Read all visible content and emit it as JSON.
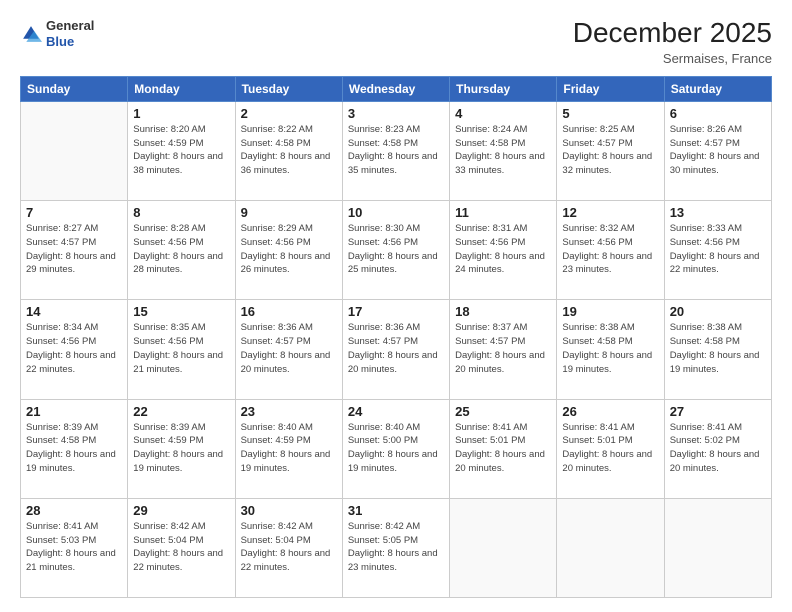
{
  "logo": {
    "general": "General",
    "blue": "Blue"
  },
  "title": "December 2025",
  "subtitle": "Sermaises, France",
  "days_header": [
    "Sunday",
    "Monday",
    "Tuesday",
    "Wednesday",
    "Thursday",
    "Friday",
    "Saturday"
  ],
  "weeks": [
    [
      {
        "num": "",
        "info": ""
      },
      {
        "num": "1",
        "info": "Sunrise: 8:20 AM\nSunset: 4:59 PM\nDaylight: 8 hours\nand 38 minutes."
      },
      {
        "num": "2",
        "info": "Sunrise: 8:22 AM\nSunset: 4:58 PM\nDaylight: 8 hours\nand 36 minutes."
      },
      {
        "num": "3",
        "info": "Sunrise: 8:23 AM\nSunset: 4:58 PM\nDaylight: 8 hours\nand 35 minutes."
      },
      {
        "num": "4",
        "info": "Sunrise: 8:24 AM\nSunset: 4:58 PM\nDaylight: 8 hours\nand 33 minutes."
      },
      {
        "num": "5",
        "info": "Sunrise: 8:25 AM\nSunset: 4:57 PM\nDaylight: 8 hours\nand 32 minutes."
      },
      {
        "num": "6",
        "info": "Sunrise: 8:26 AM\nSunset: 4:57 PM\nDaylight: 8 hours\nand 30 minutes."
      }
    ],
    [
      {
        "num": "7",
        "info": "Sunrise: 8:27 AM\nSunset: 4:57 PM\nDaylight: 8 hours\nand 29 minutes."
      },
      {
        "num": "8",
        "info": "Sunrise: 8:28 AM\nSunset: 4:56 PM\nDaylight: 8 hours\nand 28 minutes."
      },
      {
        "num": "9",
        "info": "Sunrise: 8:29 AM\nSunset: 4:56 PM\nDaylight: 8 hours\nand 26 minutes."
      },
      {
        "num": "10",
        "info": "Sunrise: 8:30 AM\nSunset: 4:56 PM\nDaylight: 8 hours\nand 25 minutes."
      },
      {
        "num": "11",
        "info": "Sunrise: 8:31 AM\nSunset: 4:56 PM\nDaylight: 8 hours\nand 24 minutes."
      },
      {
        "num": "12",
        "info": "Sunrise: 8:32 AM\nSunset: 4:56 PM\nDaylight: 8 hours\nand 23 minutes."
      },
      {
        "num": "13",
        "info": "Sunrise: 8:33 AM\nSunset: 4:56 PM\nDaylight: 8 hours\nand 22 minutes."
      }
    ],
    [
      {
        "num": "14",
        "info": "Sunrise: 8:34 AM\nSunset: 4:56 PM\nDaylight: 8 hours\nand 22 minutes."
      },
      {
        "num": "15",
        "info": "Sunrise: 8:35 AM\nSunset: 4:56 PM\nDaylight: 8 hours\nand 21 minutes."
      },
      {
        "num": "16",
        "info": "Sunrise: 8:36 AM\nSunset: 4:57 PM\nDaylight: 8 hours\nand 20 minutes."
      },
      {
        "num": "17",
        "info": "Sunrise: 8:36 AM\nSunset: 4:57 PM\nDaylight: 8 hours\nand 20 minutes."
      },
      {
        "num": "18",
        "info": "Sunrise: 8:37 AM\nSunset: 4:57 PM\nDaylight: 8 hours\nand 20 minutes."
      },
      {
        "num": "19",
        "info": "Sunrise: 8:38 AM\nSunset: 4:58 PM\nDaylight: 8 hours\nand 19 minutes."
      },
      {
        "num": "20",
        "info": "Sunrise: 8:38 AM\nSunset: 4:58 PM\nDaylight: 8 hours\nand 19 minutes."
      }
    ],
    [
      {
        "num": "21",
        "info": "Sunrise: 8:39 AM\nSunset: 4:58 PM\nDaylight: 8 hours\nand 19 minutes."
      },
      {
        "num": "22",
        "info": "Sunrise: 8:39 AM\nSunset: 4:59 PM\nDaylight: 8 hours\nand 19 minutes."
      },
      {
        "num": "23",
        "info": "Sunrise: 8:40 AM\nSunset: 4:59 PM\nDaylight: 8 hours\nand 19 minutes."
      },
      {
        "num": "24",
        "info": "Sunrise: 8:40 AM\nSunset: 5:00 PM\nDaylight: 8 hours\nand 19 minutes."
      },
      {
        "num": "25",
        "info": "Sunrise: 8:41 AM\nSunset: 5:01 PM\nDaylight: 8 hours\nand 20 minutes."
      },
      {
        "num": "26",
        "info": "Sunrise: 8:41 AM\nSunset: 5:01 PM\nDaylight: 8 hours\nand 20 minutes."
      },
      {
        "num": "27",
        "info": "Sunrise: 8:41 AM\nSunset: 5:02 PM\nDaylight: 8 hours\nand 20 minutes."
      }
    ],
    [
      {
        "num": "28",
        "info": "Sunrise: 8:41 AM\nSunset: 5:03 PM\nDaylight: 8 hours\nand 21 minutes."
      },
      {
        "num": "29",
        "info": "Sunrise: 8:42 AM\nSunset: 5:04 PM\nDaylight: 8 hours\nand 22 minutes."
      },
      {
        "num": "30",
        "info": "Sunrise: 8:42 AM\nSunset: 5:04 PM\nDaylight: 8 hours\nand 22 minutes."
      },
      {
        "num": "31",
        "info": "Sunrise: 8:42 AM\nSunset: 5:05 PM\nDaylight: 8 hours\nand 23 minutes."
      },
      {
        "num": "",
        "info": ""
      },
      {
        "num": "",
        "info": ""
      },
      {
        "num": "",
        "info": ""
      }
    ]
  ]
}
